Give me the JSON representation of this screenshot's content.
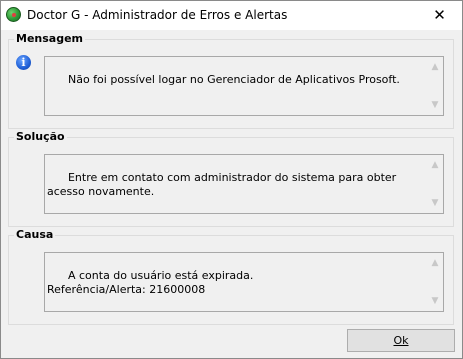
{
  "window": {
    "title": "Doctor G - Administrador de Erros e Alertas",
    "close_glyph": "✕"
  },
  "sections": [
    {
      "label": "Mensagem",
      "icon": "info-icon",
      "text": "Não foi possível logar no Gerenciador de Aplicativos Prosoft."
    },
    {
      "label": "Solução",
      "text": "Entre em contato com administrador do sistema para obter acesso novamente."
    },
    {
      "label": "Causa",
      "text": "A conta do usuário está expirada.\nReferência/Alerta: 21600008"
    }
  ],
  "buttons": {
    "ok_label": "Ok"
  }
}
